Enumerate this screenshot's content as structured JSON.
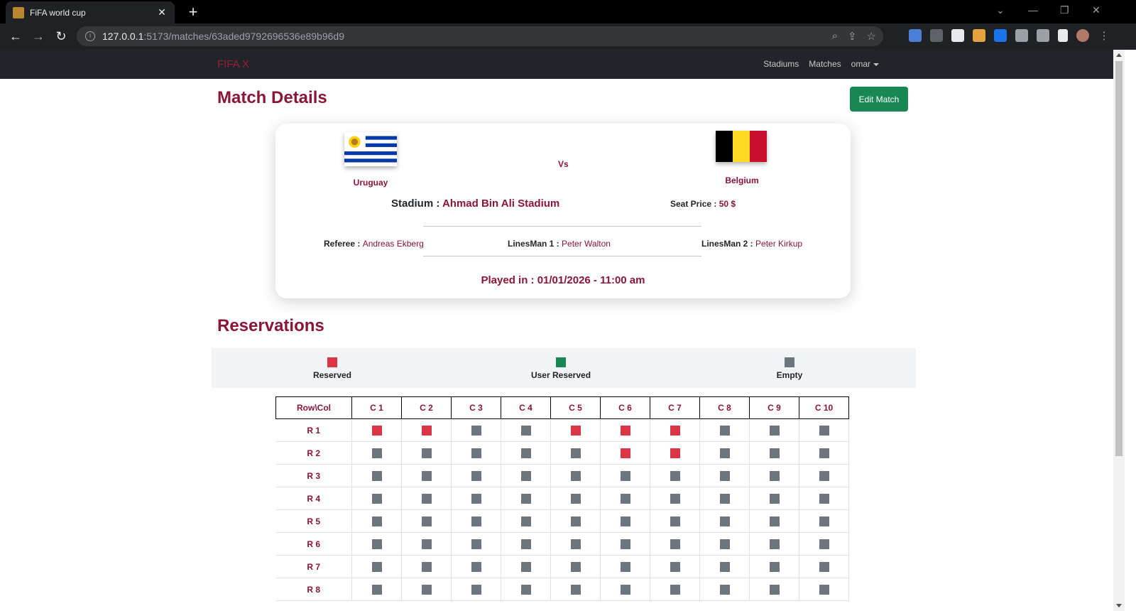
{
  "browser": {
    "tab_title": "FiFA world cup",
    "url_host": "127.0.0.1",
    "url_path": ":5173/matches/63aded9792696536e89b96d9"
  },
  "nav": {
    "brand": "FIFA X",
    "links": [
      "Stadiums",
      "Matches",
      "omar"
    ]
  },
  "page": {
    "title": "Match Details",
    "edit_button": "Edit Match"
  },
  "match": {
    "home_team": "Uruguay",
    "away_team": "Belgium",
    "vs": "Vs",
    "stadium_label": "Stadium :",
    "stadium": "Ahmad Bin Ali Stadium",
    "seat_price_label": "Seat Price :",
    "seat_price": "50 $",
    "referee_label": "Referee :",
    "referee": "Andreas Ekberg",
    "linesman1_label": "LinesMan 1 :",
    "linesman1": "Peter Walton",
    "linesman2_label": "LinesMan 2 :",
    "linesman2": "Peter Kirkup",
    "played_in": "Played in : 01/01/2026 - 11:00 am"
  },
  "reservations": {
    "title": "Reservations",
    "legend": [
      {
        "label": "Reserved",
        "color": "#dc3545"
      },
      {
        "label": "User Reserved",
        "color": "#198754"
      },
      {
        "label": "Empty",
        "color": "#6c757d"
      }
    ],
    "header_corner": "Row\\Col",
    "columns": [
      "C 1",
      "C 2",
      "C 3",
      "C 4",
      "C 5",
      "C 6",
      "C 7",
      "C 8",
      "C 9",
      "C 10"
    ],
    "rows": [
      {
        "label": "R 1",
        "seats": [
          "R",
          "R",
          "E",
          "E",
          "R",
          "R",
          "R",
          "E",
          "E",
          "E"
        ]
      },
      {
        "label": "R 2",
        "seats": [
          "E",
          "E",
          "E",
          "E",
          "E",
          "R",
          "R",
          "E",
          "E",
          "E"
        ]
      },
      {
        "label": "R 3",
        "seats": [
          "E",
          "E",
          "E",
          "E",
          "E",
          "E",
          "E",
          "E",
          "E",
          "E"
        ]
      },
      {
        "label": "R 4",
        "seats": [
          "E",
          "E",
          "E",
          "E",
          "E",
          "E",
          "E",
          "E",
          "E",
          "E"
        ]
      },
      {
        "label": "R 5",
        "seats": [
          "E",
          "E",
          "E",
          "E",
          "E",
          "E",
          "E",
          "E",
          "E",
          "E"
        ]
      },
      {
        "label": "R 6",
        "seats": [
          "E",
          "E",
          "E",
          "E",
          "E",
          "E",
          "E",
          "E",
          "E",
          "E"
        ]
      },
      {
        "label": "R 7",
        "seats": [
          "E",
          "E",
          "E",
          "E",
          "E",
          "E",
          "E",
          "E",
          "E",
          "E"
        ]
      },
      {
        "label": "R 8",
        "seats": [
          "E",
          "E",
          "E",
          "E",
          "E",
          "E",
          "E",
          "E",
          "E",
          "E"
        ]
      }
    ]
  },
  "colors": {
    "accent": "#8a1538",
    "reserved": "#dc3545",
    "user_reserved": "#198754",
    "empty": "#6c757d"
  }
}
